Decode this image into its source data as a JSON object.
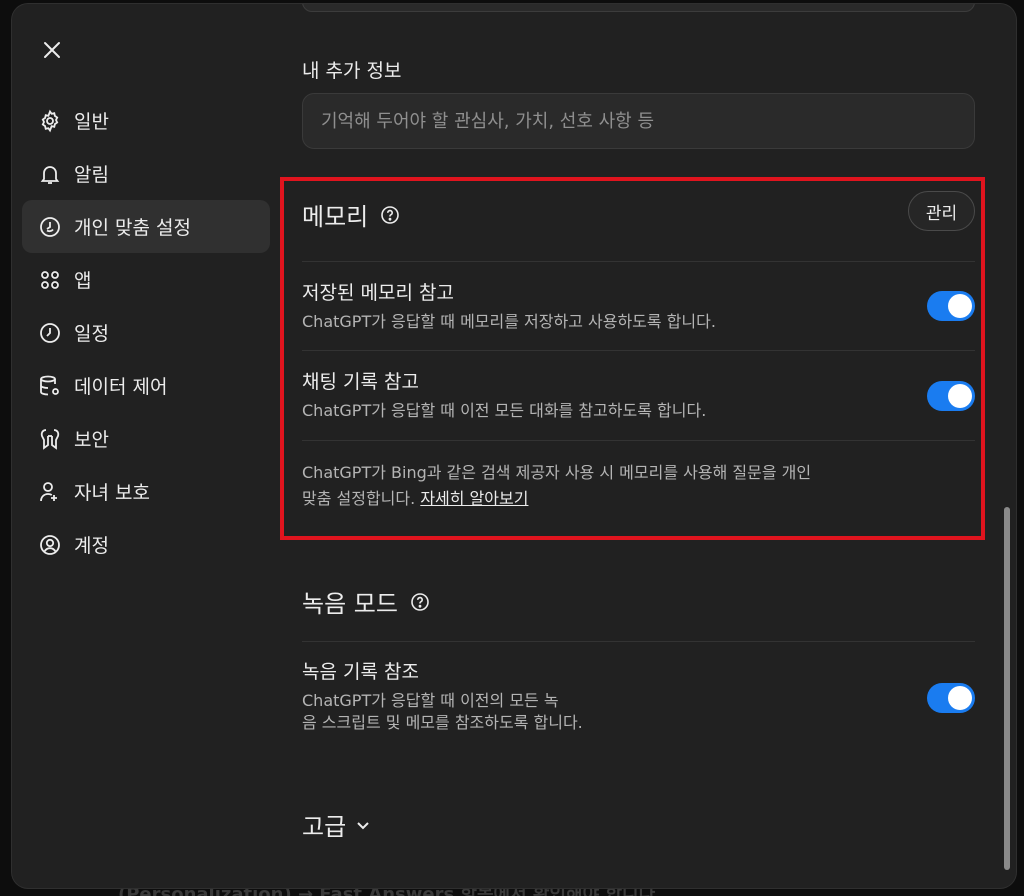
{
  "backdrop": {
    "text": "(Personalization) → Fast Answers 항목에서 확인해야 합니다"
  },
  "sidebar": {
    "close_label": "✕",
    "items": [
      {
        "label": "일반",
        "icon": "gear-icon"
      },
      {
        "label": "알림",
        "icon": "bell-icon"
      },
      {
        "label": "개인 맞춤 설정",
        "icon": "personalization-icon",
        "active": true
      },
      {
        "label": "앱",
        "icon": "apps-grid-icon"
      },
      {
        "label": "일정",
        "icon": "clock-icon"
      },
      {
        "label": "데이터 제어",
        "icon": "database-gear-icon"
      },
      {
        "label": "보안",
        "icon": "security-icon"
      },
      {
        "label": "자녀 보호",
        "icon": "parental-controls-icon"
      },
      {
        "label": "계정",
        "icon": "account-icon"
      }
    ]
  },
  "about_you": {
    "label": "내 추가 정보",
    "placeholder": "기억해 두어야 할 관심사, 가치, 선호 사항 등",
    "value": ""
  },
  "memory": {
    "title": "메모리",
    "manage_label": "관리",
    "saved_memories": {
      "title": "저장된 메모리 참고",
      "description": "ChatGPT가 응답할 때 메모리를 저장하고 사용하도록 합니다.",
      "enabled": true
    },
    "chat_history": {
      "title": "채팅 기록 참고",
      "description": "ChatGPT가 응답할 때 이전 모든 대화를 참고하도록 합니다.",
      "enabled": true
    },
    "footnote_line1": "ChatGPT가 Bing과 같은 검색 제공자 사용 시 메모리를 사용해 질문을 개인",
    "footnote_line2": "맞춤 설정합니다. ",
    "learn_more": "자세히 알아보기"
  },
  "record_mode": {
    "title": "녹음 모드",
    "history": {
      "title": "녹음 기록 참조",
      "description_line1": "ChatGPT가 응답할 때 이전의 모든 녹",
      "description_line2": "음 스크립트 및 메모를 참조하도록 합니다.",
      "enabled": true
    }
  },
  "advanced": {
    "label": "고급"
  },
  "colors": {
    "accent": "#1a7cf0",
    "highlight": "#e0141e",
    "background": "#212121"
  }
}
